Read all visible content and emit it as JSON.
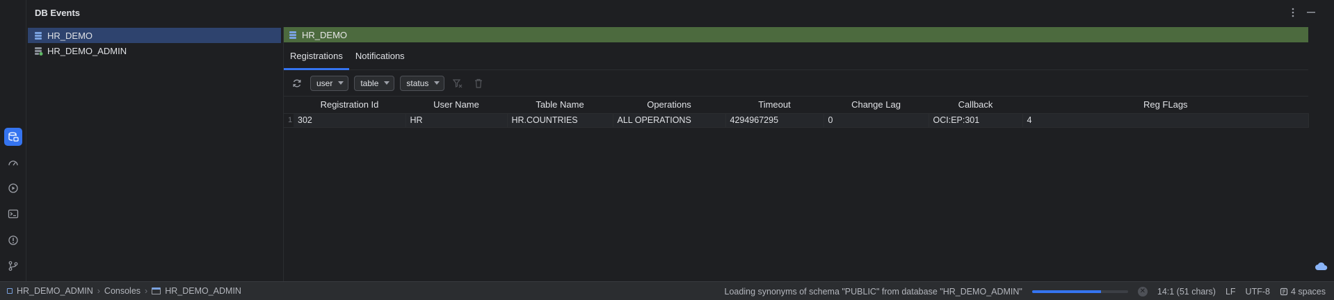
{
  "header": {
    "title": "DB Events"
  },
  "tree": {
    "items": [
      {
        "label": "HR_DEMO",
        "selected": true
      },
      {
        "label": "HR_DEMO_ADMIN",
        "selected": false
      }
    ]
  },
  "panel": {
    "title": "HR_DEMO",
    "tabs": [
      {
        "label": "Registrations",
        "active": true
      },
      {
        "label": "Notifications",
        "active": false
      }
    ],
    "filters": {
      "user": "user",
      "table": "table",
      "status": "status"
    },
    "columns": [
      "Registration Id",
      "User Name",
      "Table Name",
      "Operations",
      "Timeout",
      "Change Lag",
      "Callback",
      "Reg FLags"
    ],
    "rows": [
      {
        "num": "1",
        "cells": [
          "302",
          "HR",
          "HR.COUNTRIES",
          "ALL OPERATIONS",
          "4294967295",
          "0",
          "OCI:EP:301",
          "4"
        ]
      }
    ]
  },
  "statusbar": {
    "breadcrumb": [
      "HR_DEMO_ADMIN",
      "Consoles",
      "HR_DEMO_ADMIN"
    ],
    "message": "Loading synonyms of schema \"PUBLIC\" from database \"HR_DEMO_ADMIN\"",
    "progress": 0.72,
    "position": "14:1 (51 chars)",
    "line_ending": "LF",
    "encoding": "UTF-8",
    "indent": "4 spaces"
  },
  "colors": {
    "accent": "#3574f0",
    "panel_title_bg": "#4c6a3e",
    "selection": "#2e436e"
  }
}
